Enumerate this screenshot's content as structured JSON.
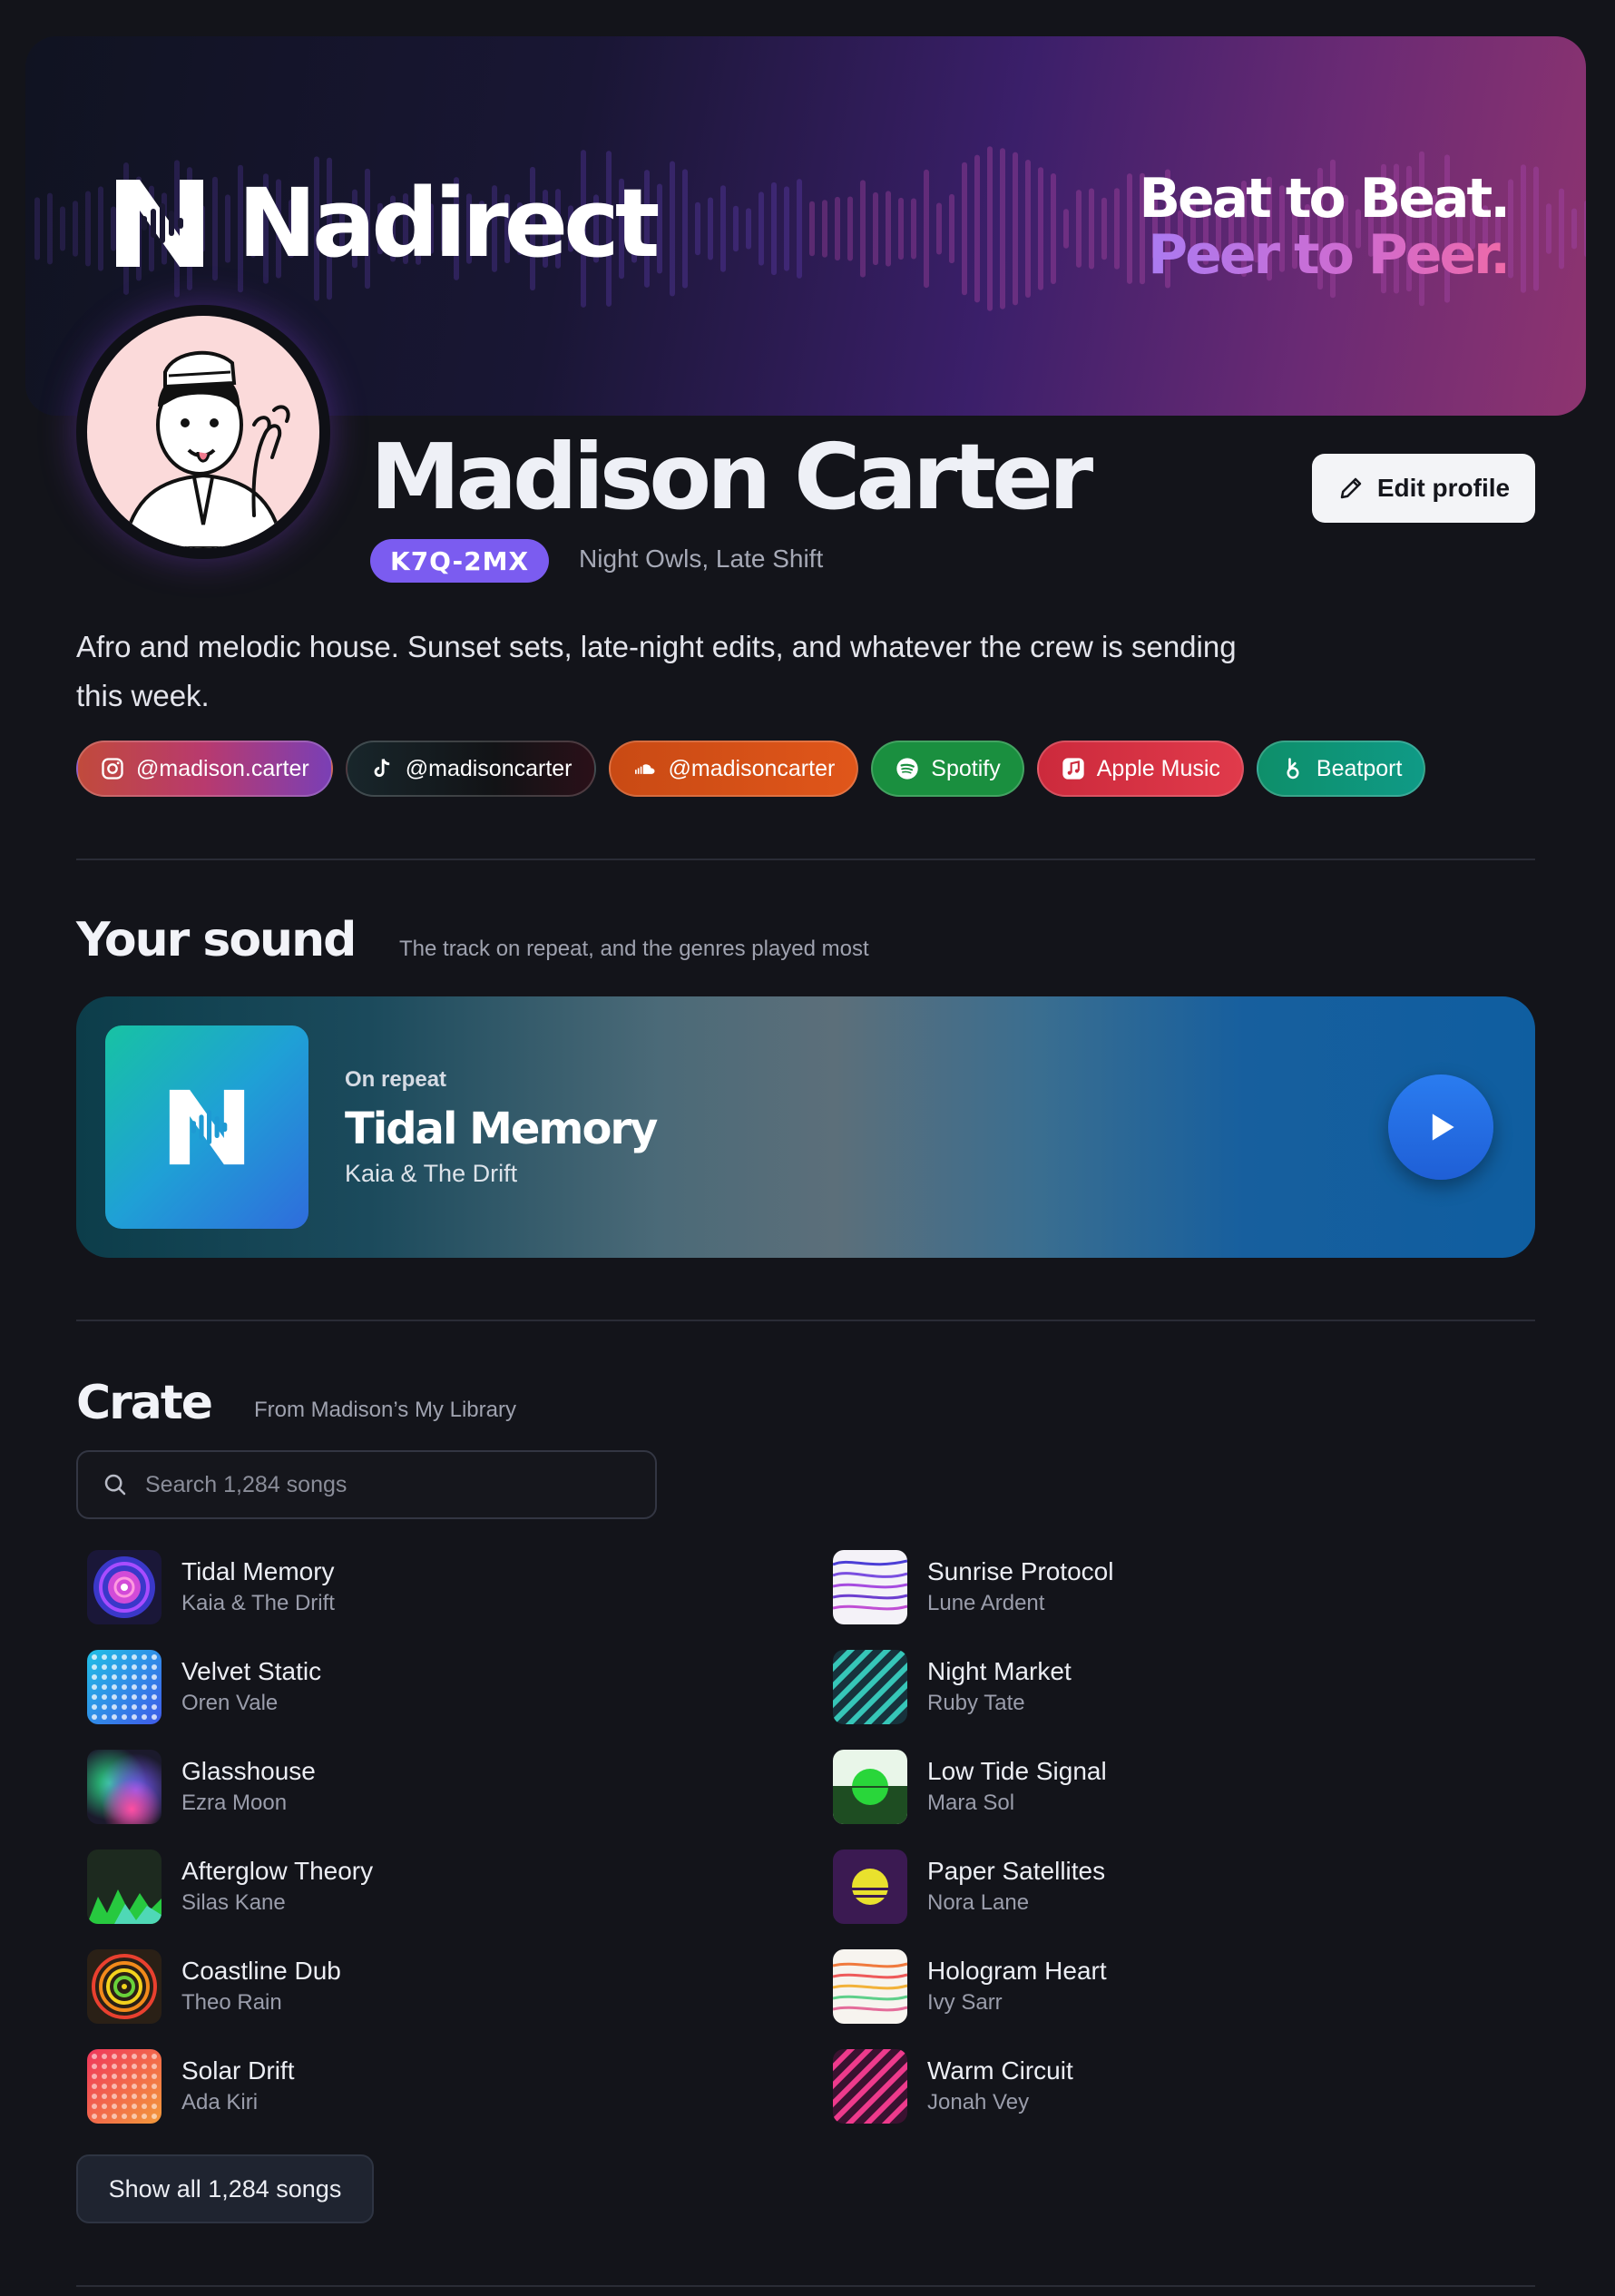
{
  "banner": {
    "brand_name": "Nadirect",
    "tagline_line1": "Beat to Beat.",
    "tagline_line2": "Peer to Peer."
  },
  "profile": {
    "name": "Madison Carter",
    "id_badge": "K7Q-2MX",
    "crews": "Night Owls, Late Shift",
    "edit_label": "Edit profile",
    "bio": "Afro and melodic house. Sunset sets, late-night edits, and whatever the crew is sending this week."
  },
  "socials": [
    {
      "label": "@madison.carter",
      "icon": "instagram-icon"
    },
    {
      "label": "@madisoncarter",
      "icon": "tiktok-icon"
    },
    {
      "label": "@madisoncarter",
      "icon": "soundcloud-icon"
    },
    {
      "label": "Spotify",
      "icon": "spotify-icon"
    },
    {
      "label": "Apple Music",
      "icon": "apple-music-icon"
    },
    {
      "label": "Beatport",
      "icon": "beatport-icon"
    }
  ],
  "sound": {
    "title": "Your sound",
    "subtitle": "The track on repeat, and the genres played most",
    "on_repeat_label": "On repeat",
    "track_title": "Tidal Memory",
    "track_artist": "Kaia & The Drift"
  },
  "crate": {
    "title": "Crate",
    "subtitle": "From Madison’s My Library",
    "search_placeholder": "Search 1,284 songs",
    "show_all_label": "Show all 1,284 songs",
    "songs": [
      {
        "title": "Tidal Memory",
        "artist": "Kaia & The Drift"
      },
      {
        "title": "Sunrise Protocol",
        "artist": "Lune Ardent"
      },
      {
        "title": "Velvet Static",
        "artist": "Oren Vale"
      },
      {
        "title": "Night Market",
        "artist": "Ruby Tate"
      },
      {
        "title": "Glasshouse",
        "artist": "Ezra Moon"
      },
      {
        "title": "Low Tide Signal",
        "artist": "Mara Sol"
      },
      {
        "title": "Afterglow Theory",
        "artist": "Silas Kane"
      },
      {
        "title": "Paper Satellites",
        "artist": "Nora Lane"
      },
      {
        "title": "Coastline Dub",
        "artist": "Theo Rain"
      },
      {
        "title": "Hologram Heart",
        "artist": "Ivy Sarr"
      },
      {
        "title": "Solar Drift",
        "artist": "Ada Kiri"
      },
      {
        "title": "Warm Circuit",
        "artist": "Jonah Vey"
      }
    ]
  },
  "colors": {
    "background": "#13141a",
    "accent_purple": "#7b5cf0",
    "play_blue": "#2a7cf0"
  }
}
